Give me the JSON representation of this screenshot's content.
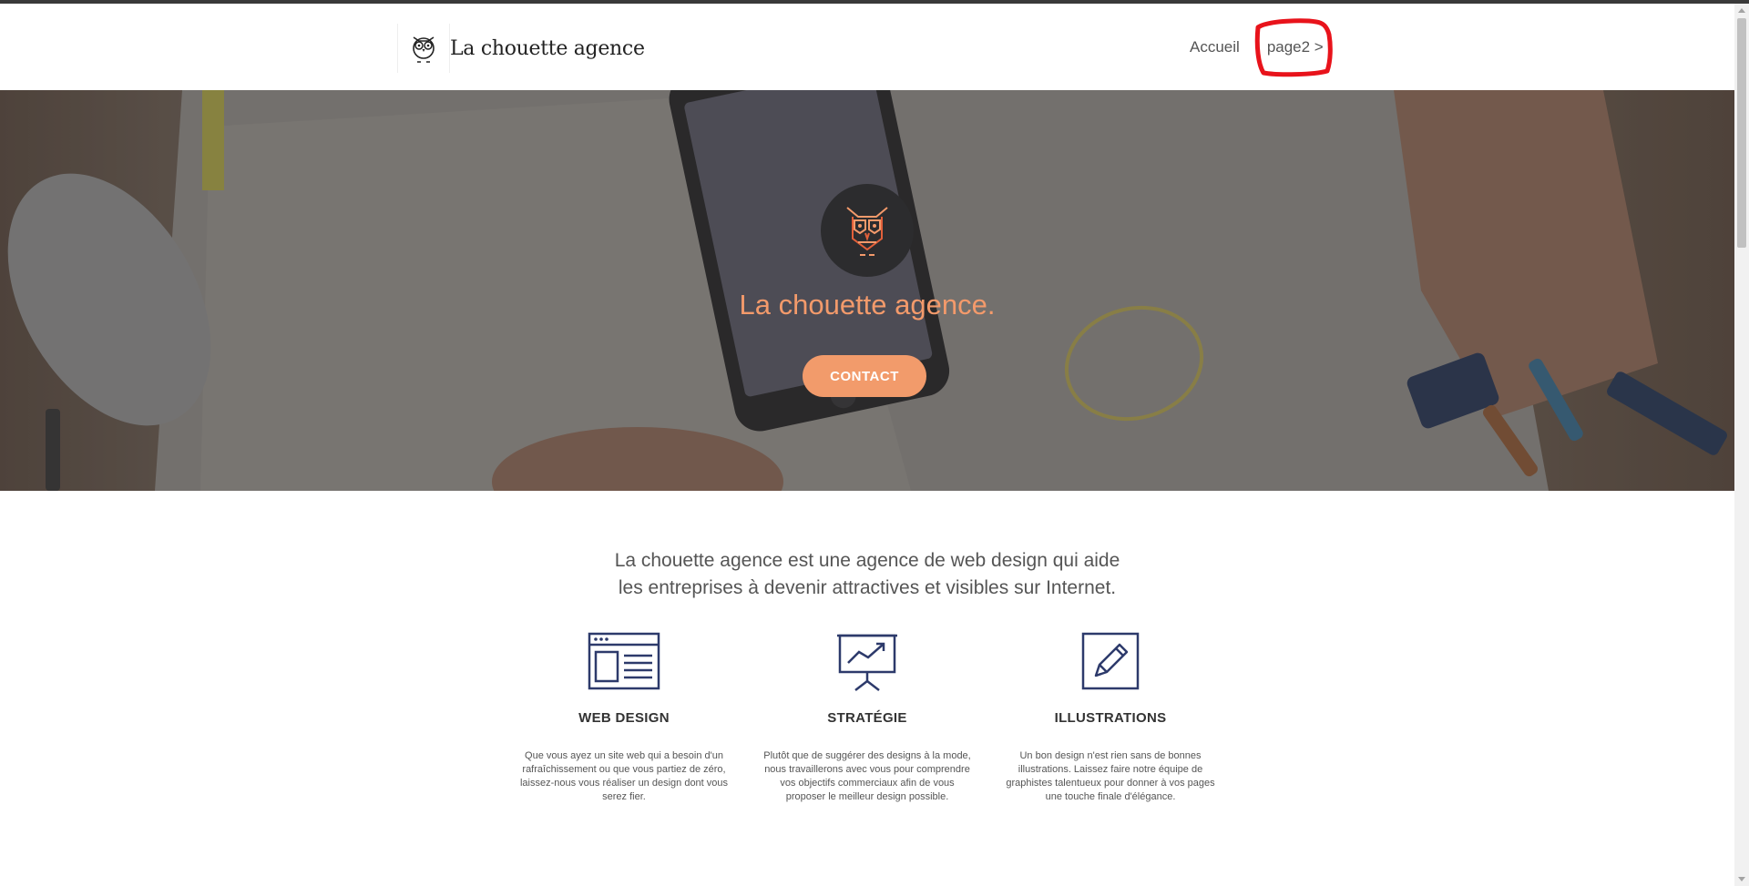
{
  "header": {
    "brand": "La chouette agence",
    "nav": [
      {
        "label": "Accueil"
      },
      {
        "label": "page2 >"
      }
    ]
  },
  "hero": {
    "title": "La chouette agence.",
    "contact_label": "CONTACT"
  },
  "intro": {
    "line1": "La chouette agence est une agence de web design qui aide",
    "line2": "les entreprises à devenir attractives et visibles sur Internet."
  },
  "features": [
    {
      "icon": "web-layout-icon",
      "title": "WEB DESIGN",
      "lines": [
        "Que vous ayez un site web qui a besoin d'un",
        "rafraîchissement ou que vous partiez de zéro,",
        "laissez-nous vous réaliser un design dont vous",
        "serez fier."
      ]
    },
    {
      "icon": "presentation-chart-icon",
      "title": "STRATÉGIE",
      "lines": [
        "Plutôt que de suggérer des designs à la mode,",
        "nous travaillerons avec vous pour comprendre",
        "vos objectifs commerciaux afin de vous",
        "proposer le meilleur design possible."
      ]
    },
    {
      "icon": "pencil-icon",
      "title": "ILLUSTRATIONS",
      "lines": [
        "Un bon design n'est rien sans de bonnes",
        "illustrations. Laissez faire notre équipe de",
        "graphistes talentueux pour donner à vos pages",
        "une touche finale d'élégance."
      ]
    }
  ],
  "colors": {
    "accent": "#f29b6b",
    "icon_navy": "#2d3a6b",
    "annotation": "#e8131b"
  }
}
